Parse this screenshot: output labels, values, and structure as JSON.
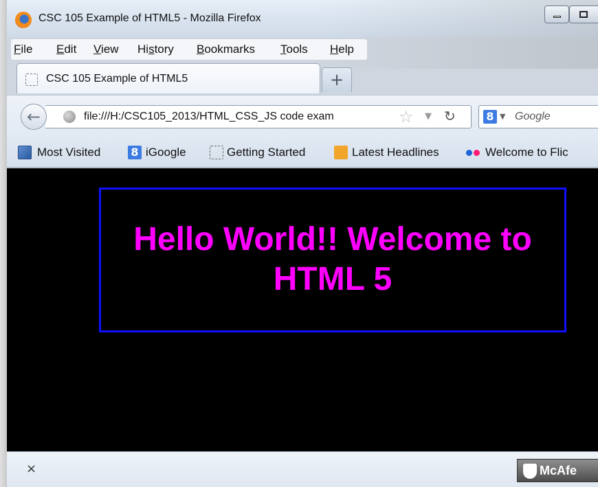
{
  "window": {
    "title": "CSC 105 Example of HTML5 - Mozilla Firefox"
  },
  "menu": [
    {
      "first": "F",
      "rest": "ile"
    },
    {
      "first": "E",
      "rest": "dit"
    },
    {
      "first": "V",
      "rest": "iew"
    },
    {
      "pre": "Hi",
      "first": "s",
      "rest": "tory"
    },
    {
      "first": "B",
      "rest": "ookmarks"
    },
    {
      "first": "T",
      "rest": "ools"
    },
    {
      "first": "H",
      "rest": "elp"
    }
  ],
  "tab": {
    "title": "CSC 105 Example of HTML5",
    "new_tab_label": "+"
  },
  "nav": {
    "url": "file:///H:/CSC105_2013/HTML_CSS_JS code exam",
    "search_placeholder": "Google",
    "search_engine_letter": "8"
  },
  "bookmarks": [
    {
      "label": "Most Visited",
      "icon": "most-visited-icon"
    },
    {
      "label": "iGoogle",
      "icon": "igoogle-icon",
      "glyph": "8"
    },
    {
      "label": "Getting Started",
      "icon": "getting-started-icon"
    },
    {
      "label": "Latest Headlines",
      "icon": "rss-icon"
    },
    {
      "label": "Welcome to Flic",
      "icon": "flickr-icon"
    }
  ],
  "content": {
    "line1": "Hello World!! Welcome to",
    "line2": "HTML 5",
    "text_color": "#ff00ff",
    "box_border_color": "#1010ff",
    "background": "#000000"
  },
  "status": {
    "close_glyph": "×",
    "security_label": "McAfe"
  }
}
